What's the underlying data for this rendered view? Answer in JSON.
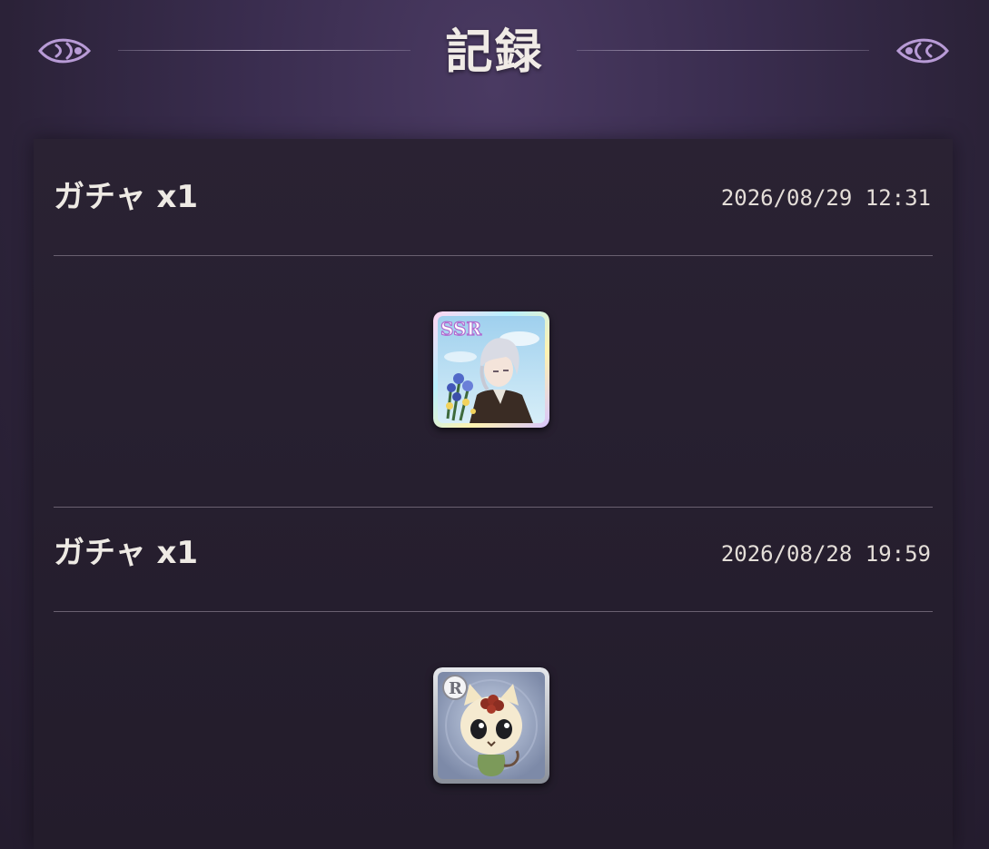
{
  "header": {
    "title": "記録"
  },
  "records": [
    {
      "title": "ガチャ x1",
      "timestamp": "2026/08/29 12:31",
      "card": {
        "rarity": "SSR",
        "subject": "silver-haired man with blue flowers"
      }
    },
    {
      "title": "ガチャ x1",
      "timestamp": "2026/08/28 19:59",
      "card": {
        "rarity": "R",
        "subject": "cat mascot with flower on head"
      }
    }
  ],
  "colors": {
    "background": "#3a2d4f",
    "panel": "#261f2f",
    "ornament": "#b79ad4",
    "text": "#ebe6df"
  }
}
